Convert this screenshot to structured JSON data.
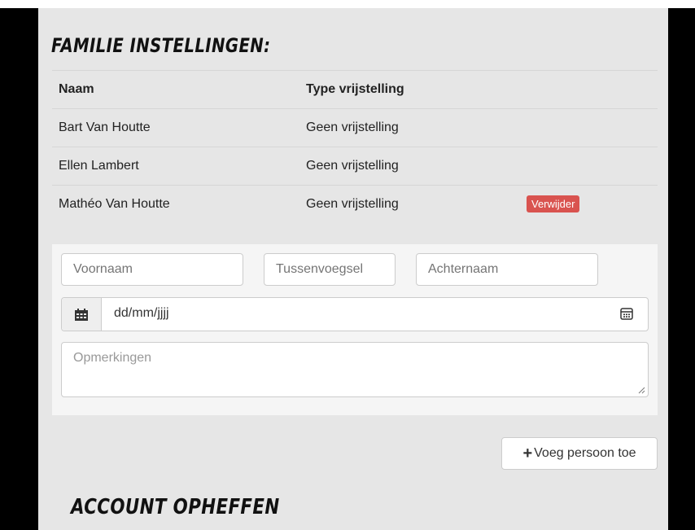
{
  "family": {
    "heading": "FAMILIE INSTELLINGEN:",
    "columns": {
      "name": "Naam",
      "type": "Type vrijstelling"
    },
    "members": [
      {
        "name": "Bart Van Houtte",
        "type": "Geen vrijstelling"
      },
      {
        "name": "Ellen Lambert",
        "type": "Geen vrijstelling"
      },
      {
        "name": "Mathéo Van Houtte",
        "type": "Geen vrijstelling",
        "action": "Verwijder"
      }
    ]
  },
  "form": {
    "first_name_placeholder": "Voornaam",
    "middle_name_placeholder": "Tussenvoegsel",
    "last_name_placeholder": "Achternaam",
    "date_placeholder": "dd/mm/jjjj",
    "remarks_placeholder": "Opmerkingen",
    "add_button": "Voeg persoon toe",
    "add_icon": "plus-icon",
    "calendar_icon": "calendar-icon"
  },
  "account": {
    "heading": "ACCOUNT OPHEFFEN"
  },
  "colors": {
    "danger": "#d9534f",
    "panel": "#e6e6e6",
    "form_bg": "#f5f5f5"
  }
}
